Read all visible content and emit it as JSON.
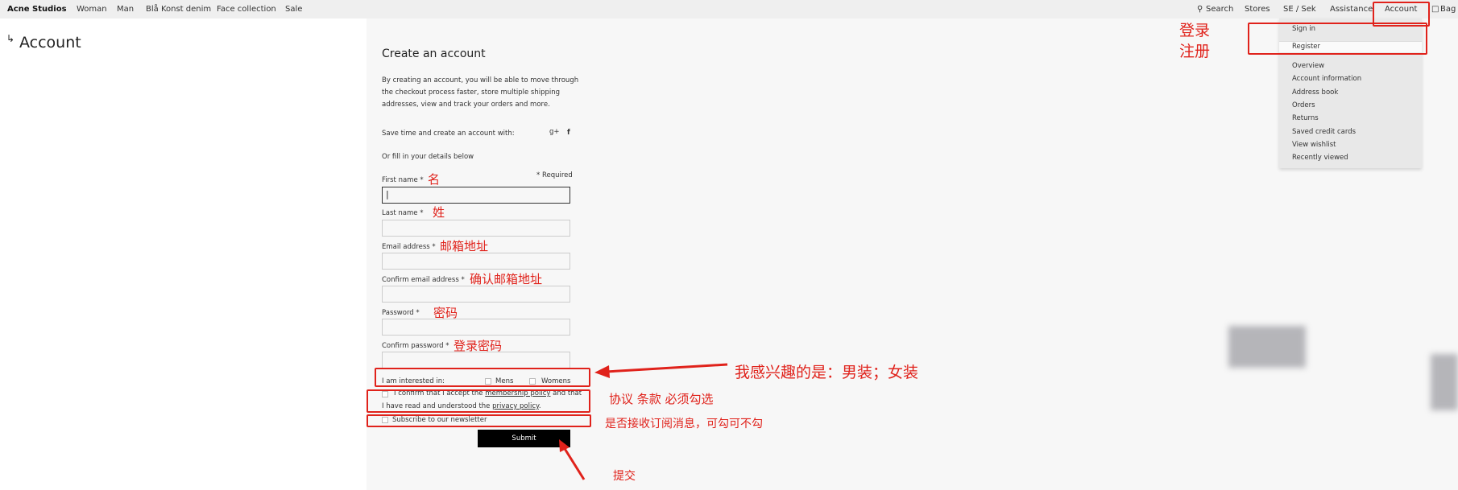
{
  "nav": {
    "brand": "Acne Studios",
    "left": [
      "Woman",
      "Man",
      "Blå Konst denim",
      "Face collection",
      "Sale"
    ],
    "search": "Search",
    "stores": "Stores",
    "currency": "SE / Sek",
    "assistance": "Assistance",
    "account": "Account",
    "bag": "Bag"
  },
  "page": {
    "title": "Account",
    "arrow": "↳"
  },
  "form": {
    "heading": "Create an account",
    "intro": [
      "By creating an account, you will be able to move through",
      "the checkout process faster, store multiple shipping",
      "addresses, view and track your orders and more."
    ],
    "social_label": "Save time and create an account with:",
    "google": "g+",
    "facebook": "f",
    "fill_label": "Or fill in your details below",
    "required": "* Required",
    "fields": [
      {
        "label": "First name *",
        "value": "|"
      },
      {
        "label": "Last name *",
        "value": ""
      },
      {
        "label": "Email address *",
        "value": ""
      },
      {
        "label": "Confirm email address *",
        "value": ""
      },
      {
        "label": "Password *",
        "value": ""
      },
      {
        "label": "Confirm password *",
        "value": ""
      }
    ],
    "interested": "I am interested in:",
    "mens": "Mens",
    "womens": "Womens",
    "confirm_pre": "I confirm that I accept the",
    "membership": "membership policy",
    "confirm_mid": "and that",
    "confirm_line2": "I have read and understood the",
    "privacy": "privacy policy",
    "period": ".",
    "newsletter": "Subscribe to our newsletter",
    "submit": "Submit"
  },
  "dropdown": {
    "items": [
      "Sign in",
      "Register",
      "Overview",
      "Account information",
      "Address book",
      "Orders",
      "Returns",
      "Saved credit cards",
      "View wishlist",
      "Recently viewed"
    ]
  },
  "annotations": {
    "login_register": [
      "登录",
      "注册"
    ],
    "fields": [
      "名",
      "姓",
      "邮箱地址",
      "确认邮箱地址",
      "密码",
      "登录密码"
    ],
    "interest": "我感兴趣的是：男装；女装",
    "terms": "协议 条款 必须勾选",
    "newsletter": "是否接收订阅消息，可勾可不勾",
    "submit": "提交"
  },
  "colors": {
    "annotation": "#e0221b",
    "submit_bg": "#000000"
  }
}
